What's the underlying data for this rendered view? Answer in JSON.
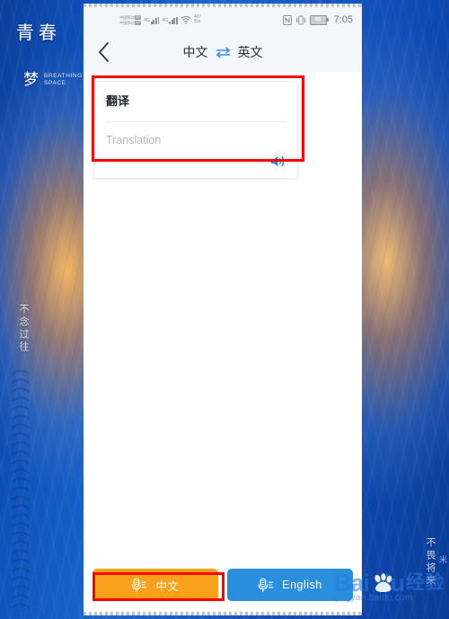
{
  "wallpaper": {
    "title": "青春",
    "dream": "梦",
    "subtitle_line1": "BREATHING",
    "subtitle_line2": "SPACE",
    "vertical_left": "不念过往",
    "vertical_right": "不畏将来",
    "stray_char": "米"
  },
  "status_bar": {
    "sim1_label": "中国移动",
    "sim1_badge": "4G",
    "sim2_label": "中国移动",
    "sim2_badge": "4G",
    "signal1_tag": "4G",
    "signal2_tag": "4G",
    "data_rate_value": "407",
    "data_rate_unit": "B/s",
    "nfc_icon": "nfc-icon",
    "vibrate_icon": "vibrate-icon",
    "battery_level": "88",
    "wifi_icon": "wifi-icon",
    "time": "7:05"
  },
  "app_bar": {
    "back_icon": "chevron-left-icon",
    "source_language": "中文",
    "swap_icon": "swap-arrows-icon",
    "target_language": "英文"
  },
  "card": {
    "source_text": "翻译",
    "target_placeholder": "Translation",
    "speaker_icon": "speaker-icon"
  },
  "bottom_bar": {
    "buttons": [
      {
        "label": "中文",
        "icon": "microphone-icon",
        "color": "#f9a11b"
      },
      {
        "label": "English",
        "icon": "microphone-icon",
        "color": "#2b8fe0"
      }
    ]
  },
  "annotations": {
    "color": "#ff0000",
    "regions": [
      "translation-card",
      "chinese-mic-button"
    ]
  },
  "watermark": {
    "brand_prefix": "Bai",
    "brand_suffix": "du",
    "brand_cn": "经验",
    "url": "jingyan.baidu.com",
    "paw_icon": "baidu-paw-icon"
  }
}
